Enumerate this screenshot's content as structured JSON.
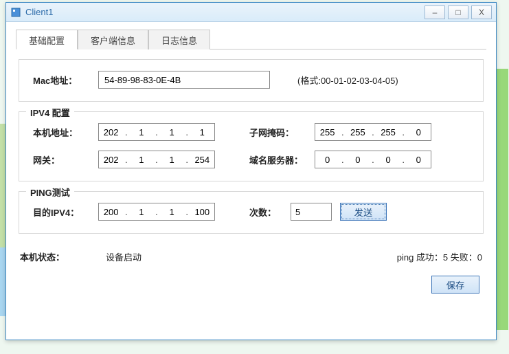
{
  "window": {
    "title": "Client1"
  },
  "tabs": {
    "basic": "基础配置",
    "client": "客户端信息",
    "log": "日志信息"
  },
  "mac": {
    "label": "Mac地址：",
    "value": "54-89-98-83-0E-4B",
    "hint": "(格式:00-01-02-03-04-05)"
  },
  "ipv4": {
    "legend": "IPV4 配置",
    "local_label": "本机地址：",
    "local": [
      "202",
      "1",
      "1",
      "1"
    ],
    "mask_label": "子网掩码：",
    "mask": [
      "255",
      "255",
      "255",
      "0"
    ],
    "gw_label": "网关：",
    "gw": [
      "202",
      "1",
      "1",
      "254"
    ],
    "dns_label": "域名服务器：",
    "dns": [
      "0",
      "0",
      "0",
      "0"
    ]
  },
  "ping": {
    "legend": "PING测试",
    "target_label": "目的IPV4：",
    "target": [
      "200",
      "1",
      "1",
      "100"
    ],
    "count_label": "次数：",
    "count": "5",
    "send": "发送"
  },
  "status": {
    "label": "本机状态：",
    "value": "设备启动",
    "ping_result": "ping 成功：5    失败：0"
  },
  "save": "保存"
}
